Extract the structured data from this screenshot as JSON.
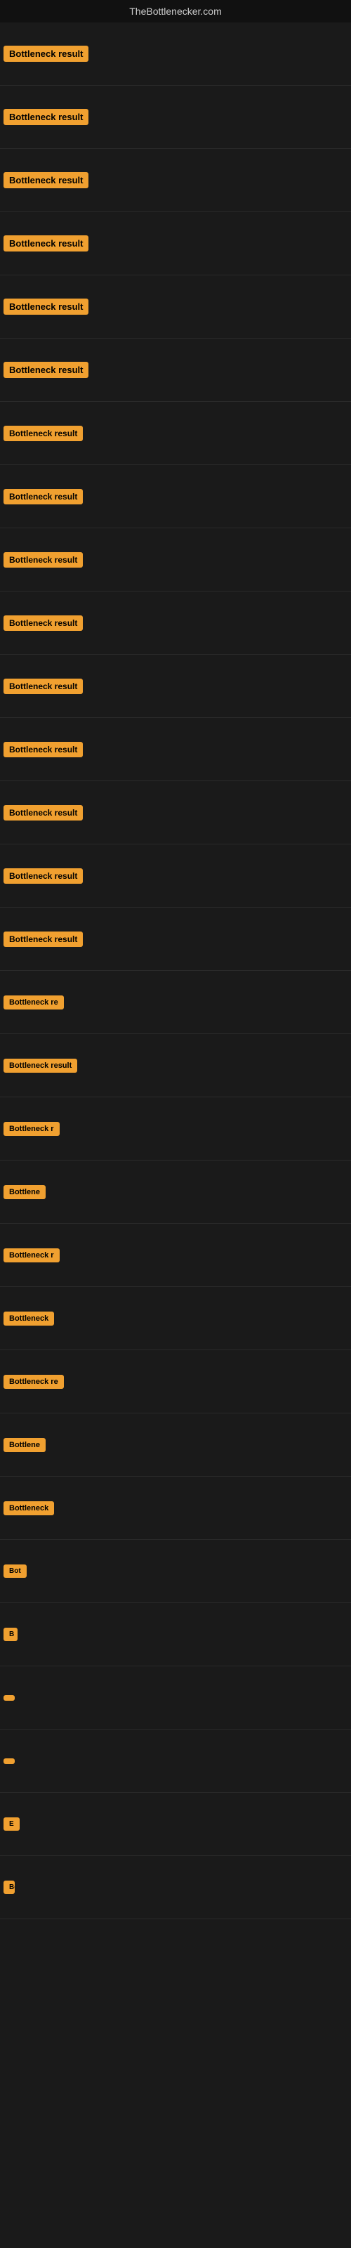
{
  "site": {
    "title": "TheBottlenecker.com"
  },
  "colors": {
    "badge_bg": "#f0a030",
    "badge_text": "#000000",
    "page_bg": "#1a1a1a",
    "border": "#2a2a2a",
    "title_text": "#cccccc"
  },
  "items": [
    {
      "id": 1,
      "label": "Bottleneck result"
    },
    {
      "id": 2,
      "label": "Bottleneck result"
    },
    {
      "id": 3,
      "label": "Bottleneck result"
    },
    {
      "id": 4,
      "label": "Bottleneck result"
    },
    {
      "id": 5,
      "label": "Bottleneck result"
    },
    {
      "id": 6,
      "label": "Bottleneck result"
    },
    {
      "id": 7,
      "label": "Bottleneck result"
    },
    {
      "id": 8,
      "label": "Bottleneck result"
    },
    {
      "id": 9,
      "label": "Bottleneck result"
    },
    {
      "id": 10,
      "label": "Bottleneck result"
    },
    {
      "id": 11,
      "label": "Bottleneck result"
    },
    {
      "id": 12,
      "label": "Bottleneck result"
    },
    {
      "id": 13,
      "label": "Bottleneck result"
    },
    {
      "id": 14,
      "label": "Bottleneck result"
    },
    {
      "id": 15,
      "label": "Bottleneck result"
    },
    {
      "id": 16,
      "label": "Bottleneck re"
    },
    {
      "id": 17,
      "label": "Bottleneck result"
    },
    {
      "id": 18,
      "label": "Bottleneck r"
    },
    {
      "id": 19,
      "label": "Bottlene"
    },
    {
      "id": 20,
      "label": "Bottleneck r"
    },
    {
      "id": 21,
      "label": "Bottleneck"
    },
    {
      "id": 22,
      "label": "Bottleneck re"
    },
    {
      "id": 23,
      "label": "Bottlene"
    },
    {
      "id": 24,
      "label": "Bottleneck"
    },
    {
      "id": 25,
      "label": "Bot"
    },
    {
      "id": 26,
      "label": "B"
    },
    {
      "id": 27,
      "label": ""
    },
    {
      "id": 28,
      "label": ""
    },
    {
      "id": 29,
      "label": "E"
    },
    {
      "id": 30,
      "label": "Bott"
    }
  ]
}
